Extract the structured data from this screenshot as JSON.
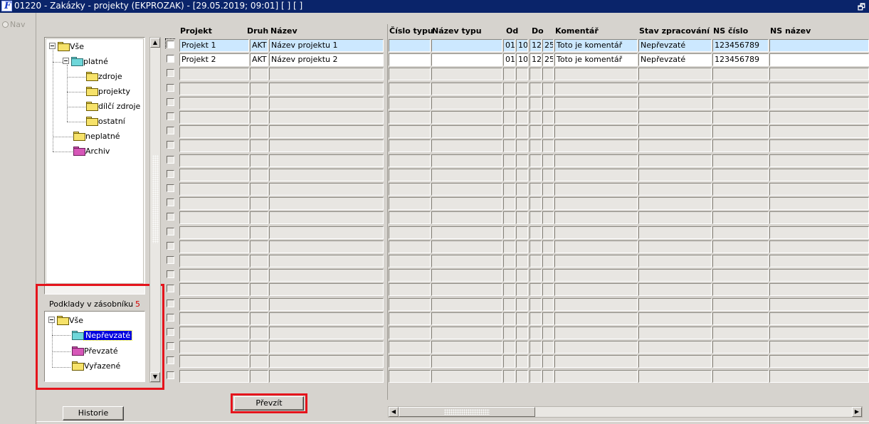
{
  "window": {
    "title": "01220 - Zakázky - projekty (EKPROZAK) - [29.05.2019; 09:01]  [ ]  [ ]",
    "app_icon": "oracle-forms-icon",
    "restore_symbol": "🗗"
  },
  "nav": {
    "label": "Nav"
  },
  "tree": {
    "root": "Vše",
    "platne": "platné",
    "platne_children": [
      "zdroje",
      "projekty",
      "dílčí zdroje",
      "ostatní"
    ],
    "neplatne": "neplatné",
    "archiv": "Archiv"
  },
  "podklady": {
    "label": "Podklady v zásobníku",
    "count": "5",
    "root": "Vše",
    "items": [
      "Nepřevzaté",
      "Převzaté",
      "Vyřazené"
    ],
    "selected": "Nepřevzaté"
  },
  "grid": {
    "headers": {
      "projekt": "Projekt",
      "druh": "Druh",
      "nazev": "Název",
      "cislo_typu": "Číslo typu",
      "nazev_typu": "Název typu",
      "od": "Od",
      "do": "Do",
      "komentar": "Komentář",
      "stav": "Stav zpracování",
      "ns_cislo": "NS číslo",
      "ns_nazev": "NS název"
    },
    "rows": [
      {
        "projekt": "Projekt 1",
        "druh": "AKT",
        "nazev": "Název projektu 1",
        "cislo_typu": "",
        "nazev_typu": "",
        "od_d": "01",
        "od_m": "10",
        "do_d": "12",
        "do_m": "25",
        "komentar": "Toto je komentář",
        "stav": "Nepřevzaté",
        "ns_cislo": "123456789",
        "ns_nazev": ""
      },
      {
        "projekt": "Projekt 2",
        "druh": "AKT",
        "nazev": "Název projektu 2",
        "cislo_typu": "",
        "nazev_typu": "",
        "od_d": "01",
        "od_m": "10",
        "do_d": "12",
        "do_m": "25",
        "komentar": "Toto je komentář",
        "stav": "Nepřevzaté",
        "ns_cislo": "123456789",
        "ns_nazev": ""
      }
    ],
    "total_rows": 24
  },
  "buttons": {
    "prevzit": "Převzít",
    "historie": "Historie"
  },
  "colors": {
    "titlebar": "#0a246a",
    "highlight_red": "#e5141c",
    "active_row": "#cce8ff",
    "selection": "#0000e0",
    "count_red": "#d40000"
  }
}
